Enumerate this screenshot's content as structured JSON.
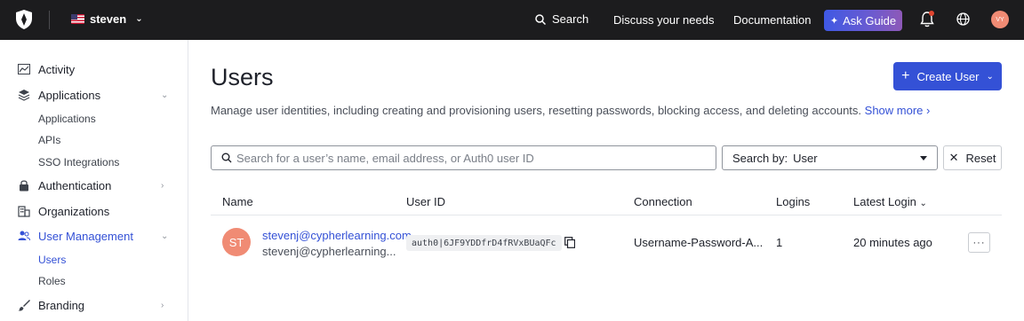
{
  "topbar": {
    "tenant": "steven",
    "search_label": "Search",
    "discuss_label": "Discuss your needs",
    "docs_label": "Documentation",
    "ask_label": "Ask Guide",
    "avatar_initials": "VY"
  },
  "sidebar": {
    "activity": "Activity",
    "applications": "Applications",
    "applications_sub": [
      "Applications",
      "APIs",
      "SSO Integrations"
    ],
    "authentication": "Authentication",
    "organizations": "Organizations",
    "user_management": "User Management",
    "user_management_sub": [
      "Users",
      "Roles"
    ],
    "branding": "Branding"
  },
  "main": {
    "title": "Users",
    "create_label": "Create User",
    "description": "Manage user identities, including creating and provisioning users, resetting passwords, blocking access, and deleting accounts.",
    "show_more": "Show more",
    "search_placeholder": "Search for a user’s name, email address, or Auth0 user ID",
    "search_by_label": "Search by:",
    "search_by_value": "User",
    "reset_label": "Reset"
  },
  "table": {
    "headers": [
      "Name",
      "User ID",
      "Connection",
      "Logins",
      "Latest Login"
    ],
    "rows": [
      {
        "initials": "ST",
        "email": "stevenj@cypherlearning.com",
        "sub": "stevenj@cypherlearning...",
        "user_id": "auth0|6JF9YDDfrD4fRVxBUaQFc",
        "connection": "Username-Password-A...",
        "logins": "1",
        "latest_login": "20 minutes ago"
      }
    ]
  },
  "colors": {
    "accent": "#3451d6",
    "topbar": "#1c1c1e",
    "avatar": "#f08b74"
  }
}
